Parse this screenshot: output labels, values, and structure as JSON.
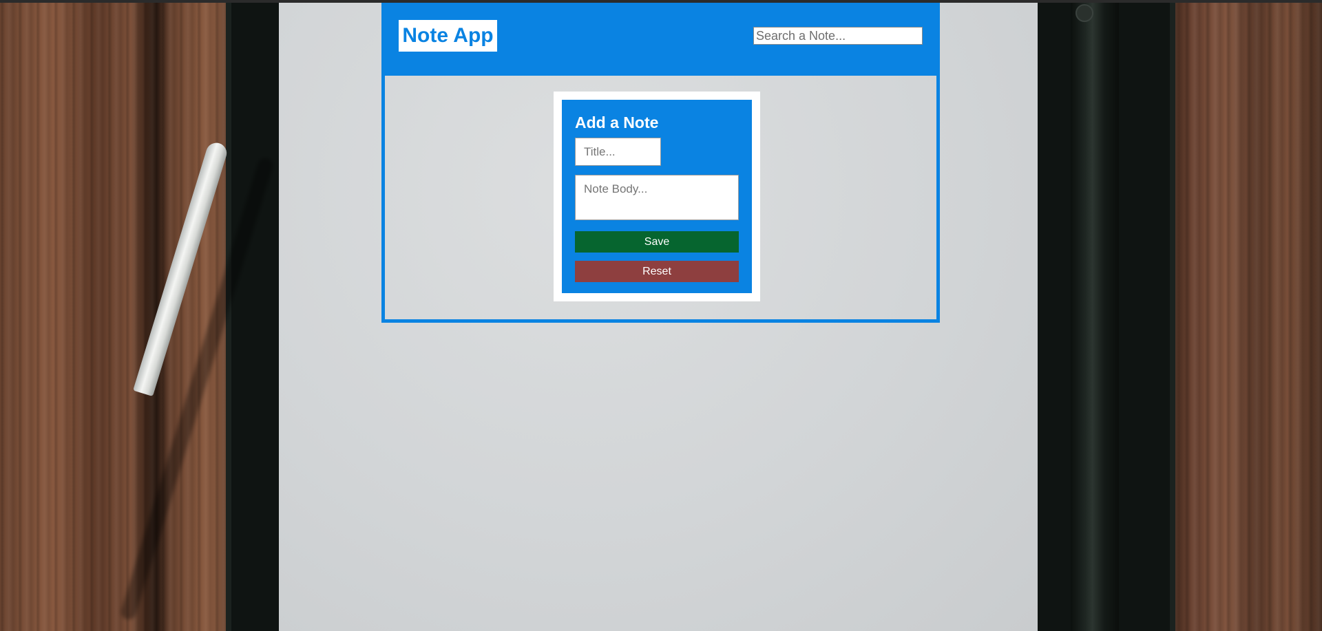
{
  "app": {
    "brand": "Note App",
    "search": {
      "placeholder": "Search a Note..."
    }
  },
  "add_note": {
    "heading": "Add a Note",
    "title_placeholder": "Title...",
    "body_placeholder": "Note Body...",
    "save_label": "Save",
    "reset_label": "Reset"
  },
  "colors": {
    "primary": "#0a83e2",
    "save": "#06652f",
    "reset": "#8e3f3f"
  }
}
